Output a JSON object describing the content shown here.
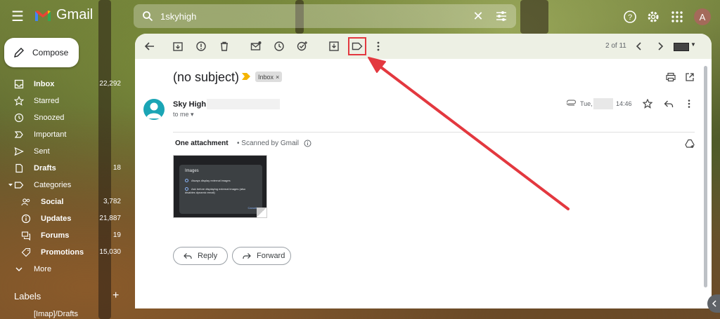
{
  "app": {
    "name": "Gmail",
    "avatar_letter": "A"
  },
  "search": {
    "value": "1skyhigh",
    "clear": "✕"
  },
  "compose": {
    "label": "Compose"
  },
  "nav": [
    {
      "key": "inbox",
      "label": "Inbox",
      "count": "22,292",
      "bold": true
    },
    {
      "key": "starred",
      "label": "Starred",
      "count": ""
    },
    {
      "key": "snoozed",
      "label": "Snoozed",
      "count": ""
    },
    {
      "key": "important",
      "label": "Important",
      "count": ""
    },
    {
      "key": "sent",
      "label": "Sent",
      "count": ""
    },
    {
      "key": "drafts",
      "label": "Drafts",
      "count": "18",
      "bold": true
    },
    {
      "key": "categories",
      "label": "Categories",
      "count": ""
    },
    {
      "key": "social",
      "label": "Social",
      "count": "3,782"
    },
    {
      "key": "updates",
      "label": "Updates",
      "count": "21,887"
    },
    {
      "key": "forums",
      "label": "Forums",
      "count": "19"
    },
    {
      "key": "promotions",
      "label": "Promotions",
      "count": "15,030"
    },
    {
      "key": "more",
      "label": "More",
      "count": ""
    }
  ],
  "labels": {
    "title": "Labels",
    "add": "+",
    "first_item": "[Imap]/Drafts"
  },
  "toolbar": {
    "pager": "2 of 11"
  },
  "email": {
    "subject": "(no subject)",
    "chip_label": "Inbox",
    "chip_close": "×",
    "sender_name": "Sky High",
    "to": "to me ▾",
    "date_prefix": "Tue,",
    "time": "14:46",
    "attachments_title": "One attachment",
    "scanned": "• Scanned by Gmail",
    "thumbnail": {
      "title": "Images",
      "option1": "Always display external images",
      "option2": "Ask before displaying external images (also disables dynamic email)",
      "cancel": "Cancel"
    }
  },
  "actions": {
    "reply": "Reply",
    "forward": "Forward"
  },
  "colors": {
    "highlight": "#e3383f",
    "avatar": "#1aa5b5",
    "important": "#f4b400"
  }
}
